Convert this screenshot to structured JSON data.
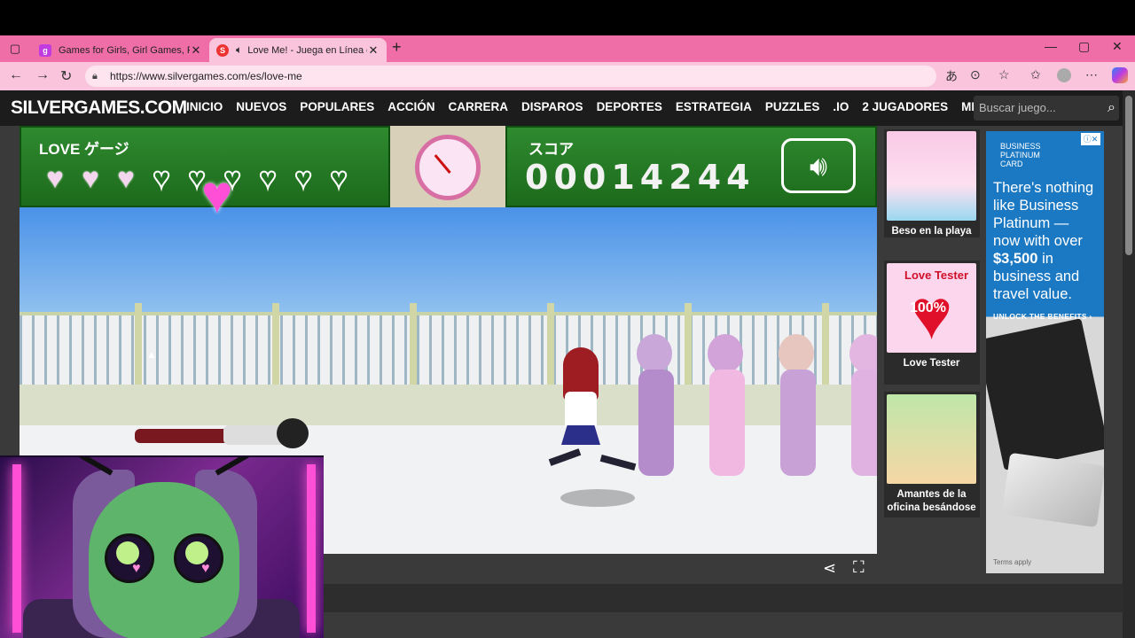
{
  "browser": {
    "tabs": [
      {
        "title": "Games for Girls, Girl Games, Play",
        "favicon": "purple-games-icon"
      },
      {
        "title": "Love Me! - Juega en Línea en",
        "favicon": "silvergames-icon",
        "muted_icon": "speaker-icon"
      }
    ],
    "url": "https://www.silvergames.com/es/love-me",
    "accent": "#f06ea8"
  },
  "site": {
    "logo": "SILVERGAMES.COM",
    "menu": [
      "INICIO",
      "NUEVOS",
      "POPULARES",
      "ACCIÓN",
      "CARRERA",
      "DISPAROS",
      "DEPORTES",
      "ESTRATEGIA",
      "PUZZLES",
      ".IO",
      "2 JUGADORES",
      "MIS"
    ],
    "search_placeholder": "Buscar juego..."
  },
  "game": {
    "love_label": "LOVE ゲージ",
    "score_label": "スコア",
    "score": "00014244",
    "hearts_total": 9,
    "hearts_filled": 3
  },
  "sidebar": {
    "items": [
      {
        "title": "Beso en la playa"
      },
      {
        "title": "Love Tester",
        "thumb_text": "Love Tester",
        "thumb_value": "100%"
      },
      {
        "title": "Amantes de la oficina besándose"
      }
    ]
  },
  "ad": {
    "brand": "BUSINESS PLATINUM CARD",
    "copy_1": "There's nothing like Business Platinum — now with over",
    "copy_bold": "$3,500",
    "copy_2": "in business and travel value.",
    "cta": "UNLOCK THE BENEFITS ›",
    "terms": "Terms apply"
  }
}
